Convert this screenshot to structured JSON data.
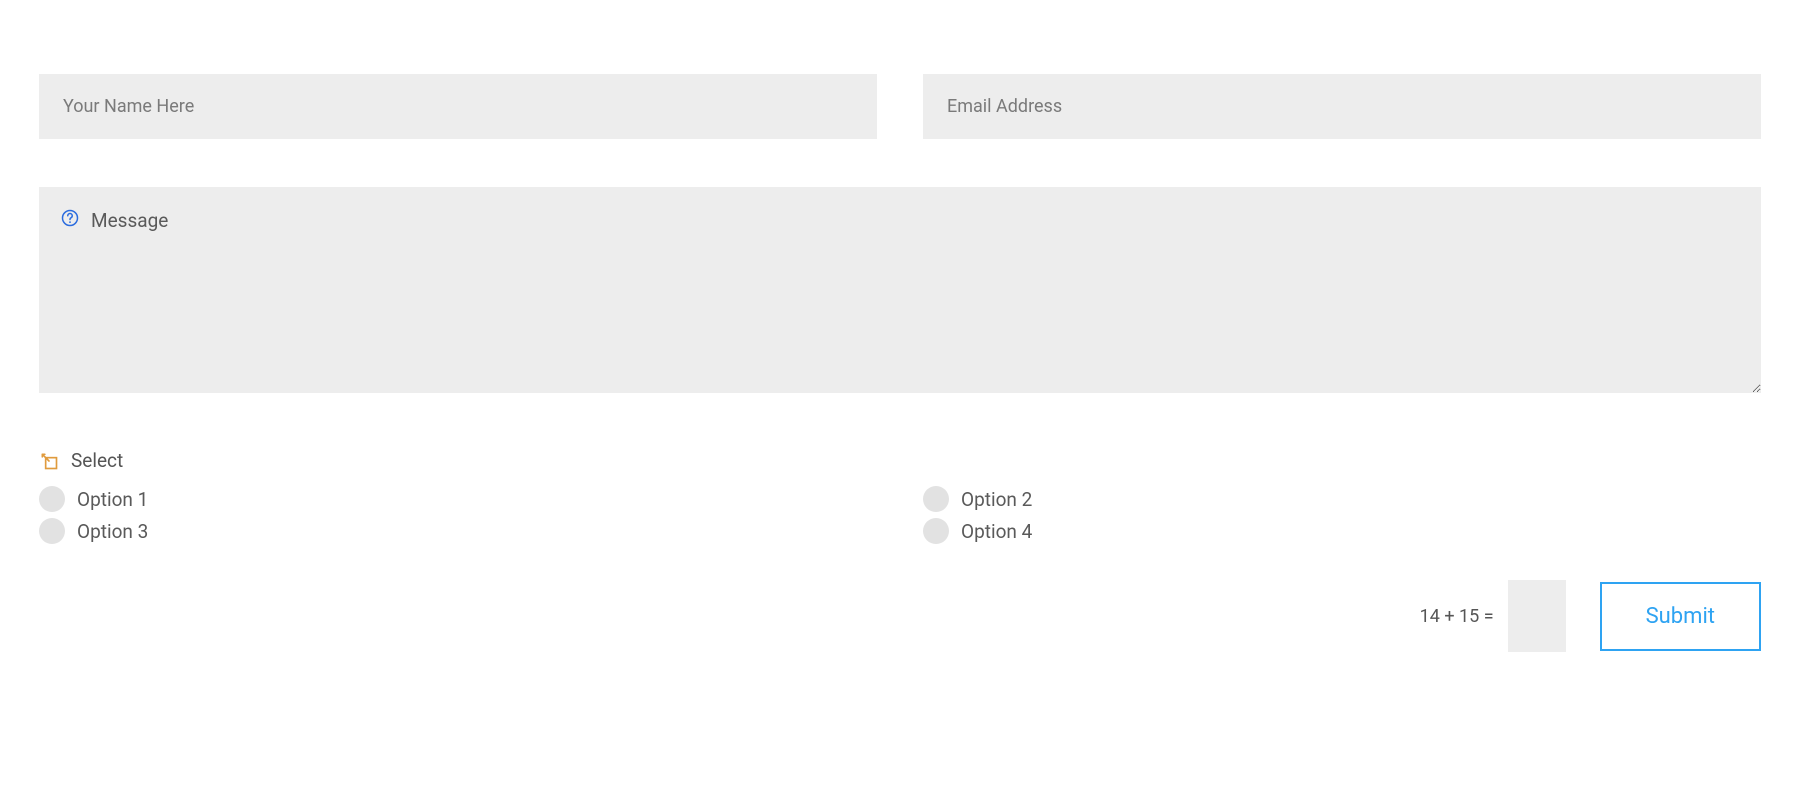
{
  "form": {
    "name": {
      "placeholder": "Your Name Here"
    },
    "email": {
      "placeholder": "Email Address"
    },
    "message": {
      "placeholder": "Message"
    },
    "select": {
      "label": "Select",
      "options": [
        "Option 1",
        "Option 2",
        "Option 3",
        "Option 4"
      ]
    },
    "captcha": {
      "question": "14 + 15 ="
    },
    "submit_label": "Submit"
  },
  "icons": {
    "help_color": "#2b6cde",
    "select_color": "#e09b3d"
  }
}
